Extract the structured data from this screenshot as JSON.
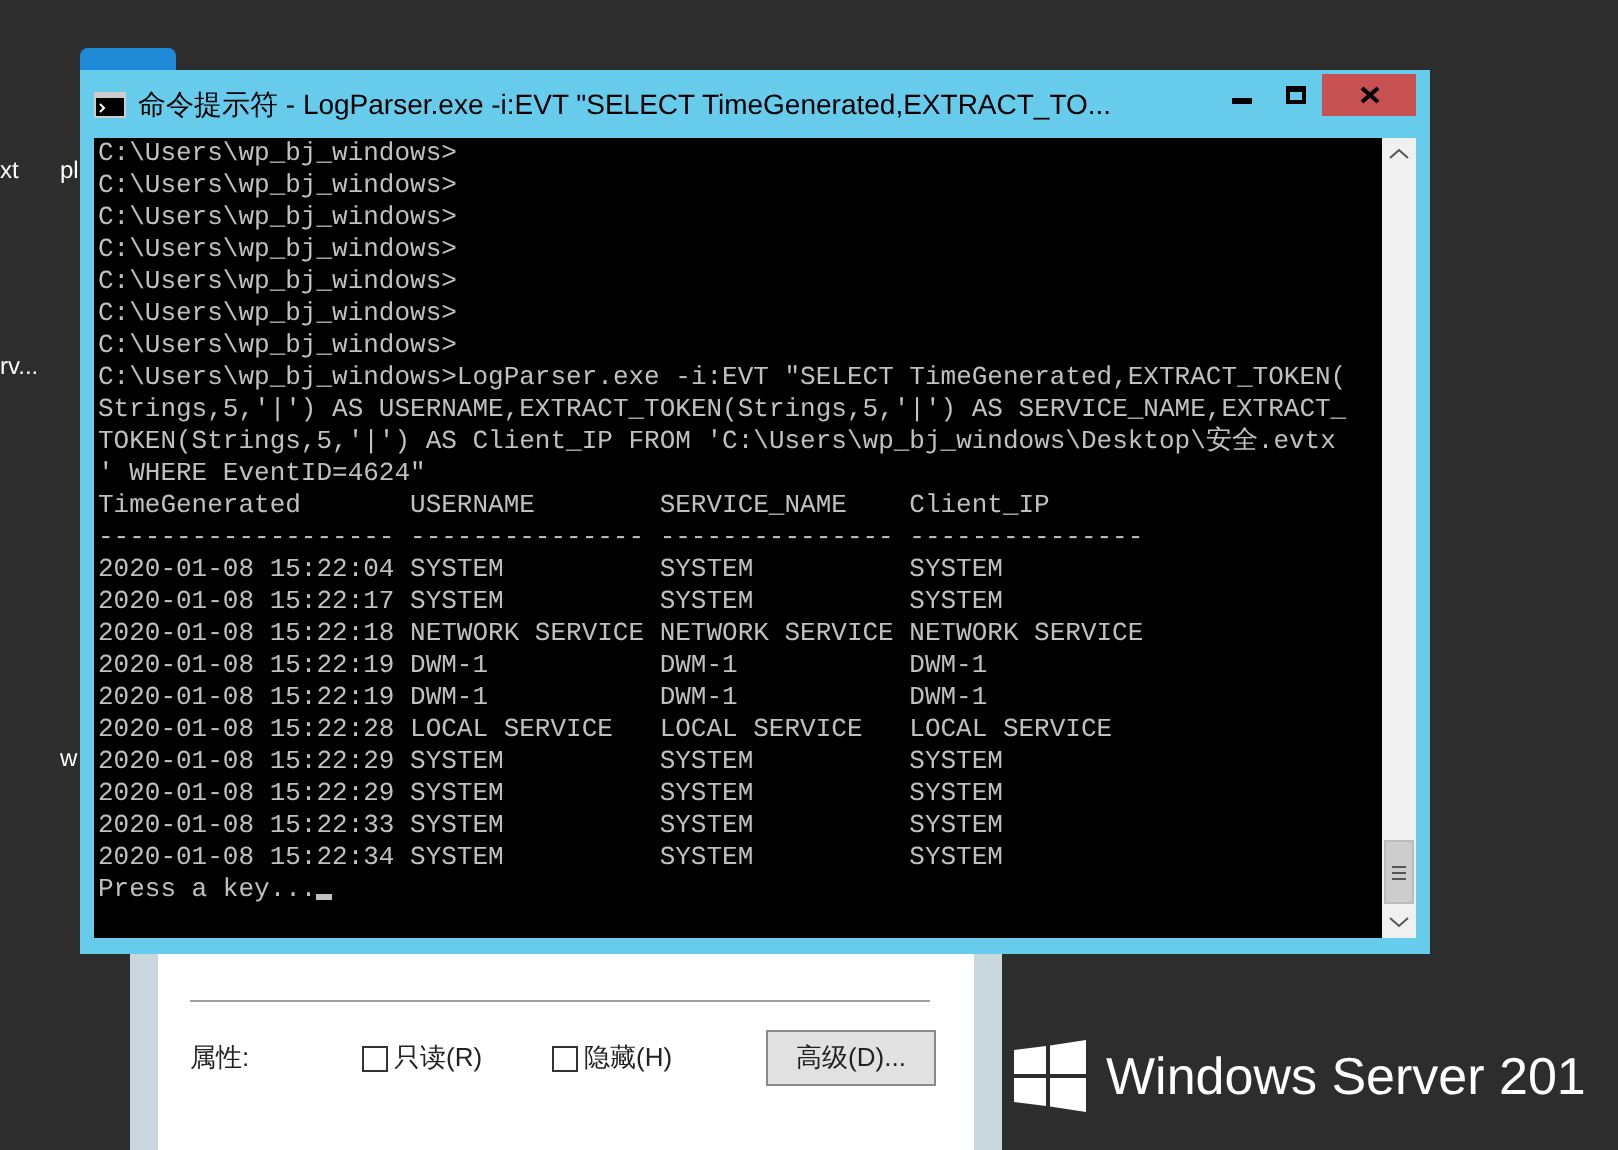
{
  "desktop_labels": [
    "xt",
    "pl",
    "rv...",
    "w"
  ],
  "console": {
    "title": "命令提示符 - LogParser.exe  -i:EVT \"SELECT TimeGenerated,EXTRACT_TO...",
    "lines": [
      "C:\\Users\\wp_bj_windows>",
      "C:\\Users\\wp_bj_windows>",
      "C:\\Users\\wp_bj_windows>",
      "C:\\Users\\wp_bj_windows>",
      "C:\\Users\\wp_bj_windows>",
      "C:\\Users\\wp_bj_windows>",
      "C:\\Users\\wp_bj_windows>",
      "C:\\Users\\wp_bj_windows>LogParser.exe -i:EVT \"SELECT TimeGenerated,EXTRACT_TOKEN(",
      "Strings,5,'|') AS USERNAME,EXTRACT_TOKEN(Strings,5,'|') AS SERVICE_NAME,EXTRACT_",
      "TOKEN(Strings,5,'|') AS Client_IP FROM 'C:\\Users\\wp_bj_windows\\Desktop\\安全.evtx",
      "' WHERE EventID=4624\""
    ],
    "table": {
      "columns": [
        "TimeGenerated",
        "USERNAME",
        "SERVICE_NAME",
        "Client_IP"
      ],
      "separator": [
        "-------------------",
        "---------------",
        "---------------",
        "---------------"
      ],
      "rows": [
        [
          "2020-01-08 15:22:04",
          "SYSTEM",
          "SYSTEM",
          "SYSTEM"
        ],
        [
          "2020-01-08 15:22:17",
          "SYSTEM",
          "SYSTEM",
          "SYSTEM"
        ],
        [
          "2020-01-08 15:22:18",
          "NETWORK SERVICE",
          "NETWORK SERVICE",
          "NETWORK SERVICE"
        ],
        [
          "2020-01-08 15:22:19",
          "DWM-1",
          "DWM-1",
          "DWM-1"
        ],
        [
          "2020-01-08 15:22:19",
          "DWM-1",
          "DWM-1",
          "DWM-1"
        ],
        [
          "2020-01-08 15:22:28",
          "LOCAL SERVICE",
          "LOCAL SERVICE",
          "LOCAL SERVICE"
        ],
        [
          "2020-01-08 15:22:29",
          "SYSTEM",
          "SYSTEM",
          "SYSTEM"
        ],
        [
          "2020-01-08 15:22:29",
          "SYSTEM",
          "SYSTEM",
          "SYSTEM"
        ],
        [
          "2020-01-08 15:22:33",
          "SYSTEM",
          "SYSTEM",
          "SYSTEM"
        ],
        [
          "2020-01-08 15:22:34",
          "SYSTEM",
          "SYSTEM",
          "SYSTEM"
        ]
      ]
    },
    "prompt": "Press a key..."
  },
  "properties_dialog": {
    "attributes_label": "属性:",
    "checkboxes": [
      {
        "label": "只读(R)",
        "checked": false
      },
      {
        "label": "隐藏(H)",
        "checked": false
      }
    ],
    "advanced_button": "高级(D)..."
  },
  "brand": "Windows Server 201"
}
